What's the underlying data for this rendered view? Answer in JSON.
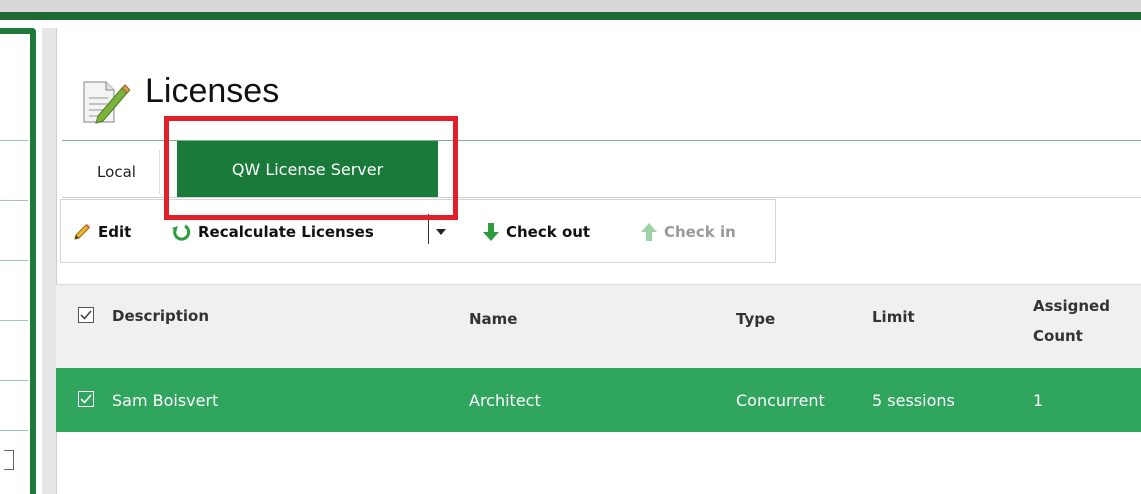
{
  "page": {
    "title": "Licenses"
  },
  "tabs": [
    {
      "label": "Local",
      "active": false
    },
    {
      "label": "QW License Server",
      "active": true
    }
  ],
  "toolbar": {
    "edit_label": "Edit",
    "recalculate_label": "Recalculate Licenses",
    "checkout_label": "Check out",
    "checkin_label": "Check in"
  },
  "grid": {
    "columns": [
      "Description",
      "Name",
      "Type",
      "Limit",
      "Assigned Count"
    ],
    "rows": [
      {
        "description": "Sam Boisvert",
        "name": "Architect",
        "type": "Concurrent",
        "limit": "5 sessions",
        "assigned_count": "1",
        "selected": true
      }
    ]
  },
  "colors": {
    "accent_green": "#1a7a3a",
    "row_selected": "#2fa55d",
    "highlight_red": "#e3202a"
  }
}
